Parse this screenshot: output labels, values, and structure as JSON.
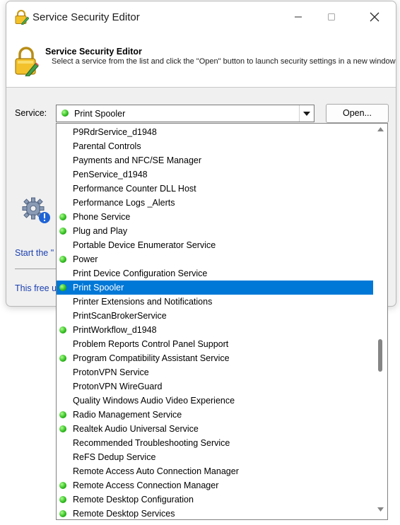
{
  "window": {
    "title": "Service Security Editor",
    "controls": {
      "minimize": "minimize",
      "maximize": "maximize",
      "close": "close"
    }
  },
  "header": {
    "title": "Service Security Editor",
    "description": "Select a service from the list and click the \"Open\" button to launch security settings in a new window."
  },
  "service_field": {
    "label": "Service:",
    "selected_value": "Print Spooler",
    "selected_running": true
  },
  "open_button": {
    "label": "Open..."
  },
  "background_text": {
    "start_link": "Start the \"",
    "free_text": "This free u"
  },
  "dropdown": {
    "items": [
      {
        "label": "P9RdrService_d1948",
        "running": false,
        "selected": false
      },
      {
        "label": "Parental Controls",
        "running": false,
        "selected": false
      },
      {
        "label": "Payments and NFC/SE Manager",
        "running": false,
        "selected": false
      },
      {
        "label": "PenService_d1948",
        "running": false,
        "selected": false
      },
      {
        "label": "Performance Counter DLL Host",
        "running": false,
        "selected": false
      },
      {
        "label": "Performance Logs _Alerts",
        "running": false,
        "selected": false
      },
      {
        "label": "Phone Service",
        "running": true,
        "selected": false
      },
      {
        "label": "Plug and Play",
        "running": true,
        "selected": false
      },
      {
        "label": "Portable Device Enumerator Service",
        "running": false,
        "selected": false
      },
      {
        "label": "Power",
        "running": true,
        "selected": false
      },
      {
        "label": "Print Device Configuration Service",
        "running": false,
        "selected": false
      },
      {
        "label": "Print Spooler",
        "running": true,
        "selected": true
      },
      {
        "label": "Printer Extensions and Notifications",
        "running": false,
        "selected": false
      },
      {
        "label": "PrintScanBrokerService",
        "running": false,
        "selected": false
      },
      {
        "label": "PrintWorkflow_d1948",
        "running": true,
        "selected": false
      },
      {
        "label": "Problem Reports Control Panel Support",
        "running": false,
        "selected": false
      },
      {
        "label": "Program Compatibility Assistant Service",
        "running": true,
        "selected": false
      },
      {
        "label": "ProtonVPN Service",
        "running": false,
        "selected": false
      },
      {
        "label": "ProtonVPN WireGuard",
        "running": false,
        "selected": false
      },
      {
        "label": "Quality Windows Audio Video Experience",
        "running": false,
        "selected": false
      },
      {
        "label": "Radio Management Service",
        "running": true,
        "selected": false
      },
      {
        "label": "Realtek Audio Universal Service",
        "running": true,
        "selected": false
      },
      {
        "label": "Recommended Troubleshooting Service",
        "running": false,
        "selected": false
      },
      {
        "label": "ReFS Dedup Service",
        "running": false,
        "selected": false
      },
      {
        "label": "Remote Access Auto Connection Manager",
        "running": false,
        "selected": false
      },
      {
        "label": "Remote Access Connection Manager",
        "running": true,
        "selected": false
      },
      {
        "label": "Remote Desktop Configuration",
        "running": true,
        "selected": false
      },
      {
        "label": "Remote Desktop Services",
        "running": true,
        "selected": false
      }
    ]
  },
  "colors": {
    "accent": "#0078d7",
    "link": "#1a3fb0",
    "running_dot": "#2db81c"
  }
}
